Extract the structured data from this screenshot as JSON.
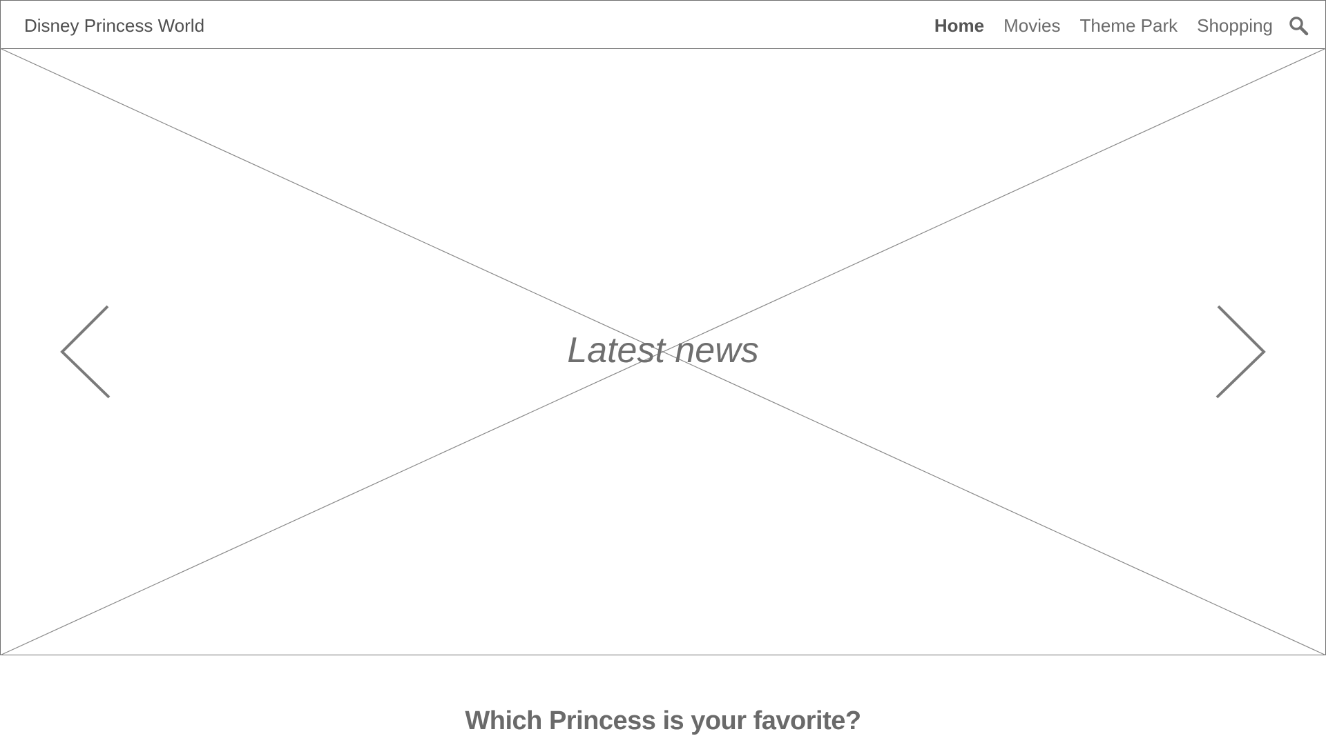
{
  "header": {
    "brand": "Disney Princess World",
    "nav": [
      {
        "label": "Home",
        "active": true
      },
      {
        "label": "Movies",
        "active": false
      },
      {
        "label": "Theme Park",
        "active": false
      },
      {
        "label": "Shopping",
        "active": false
      }
    ],
    "search_icon": "search-icon"
  },
  "hero": {
    "title": "Latest news",
    "prev_icon": "chevron-left-icon",
    "next_icon": "chevron-right-icon"
  },
  "section": {
    "title": "Which Princess is your favorite?"
  },
  "colors": {
    "text": "#4f4f4f",
    "muted": "#6b6b6b",
    "border": "#6e6e6e",
    "placeholder_line": "#8a8a8a"
  }
}
